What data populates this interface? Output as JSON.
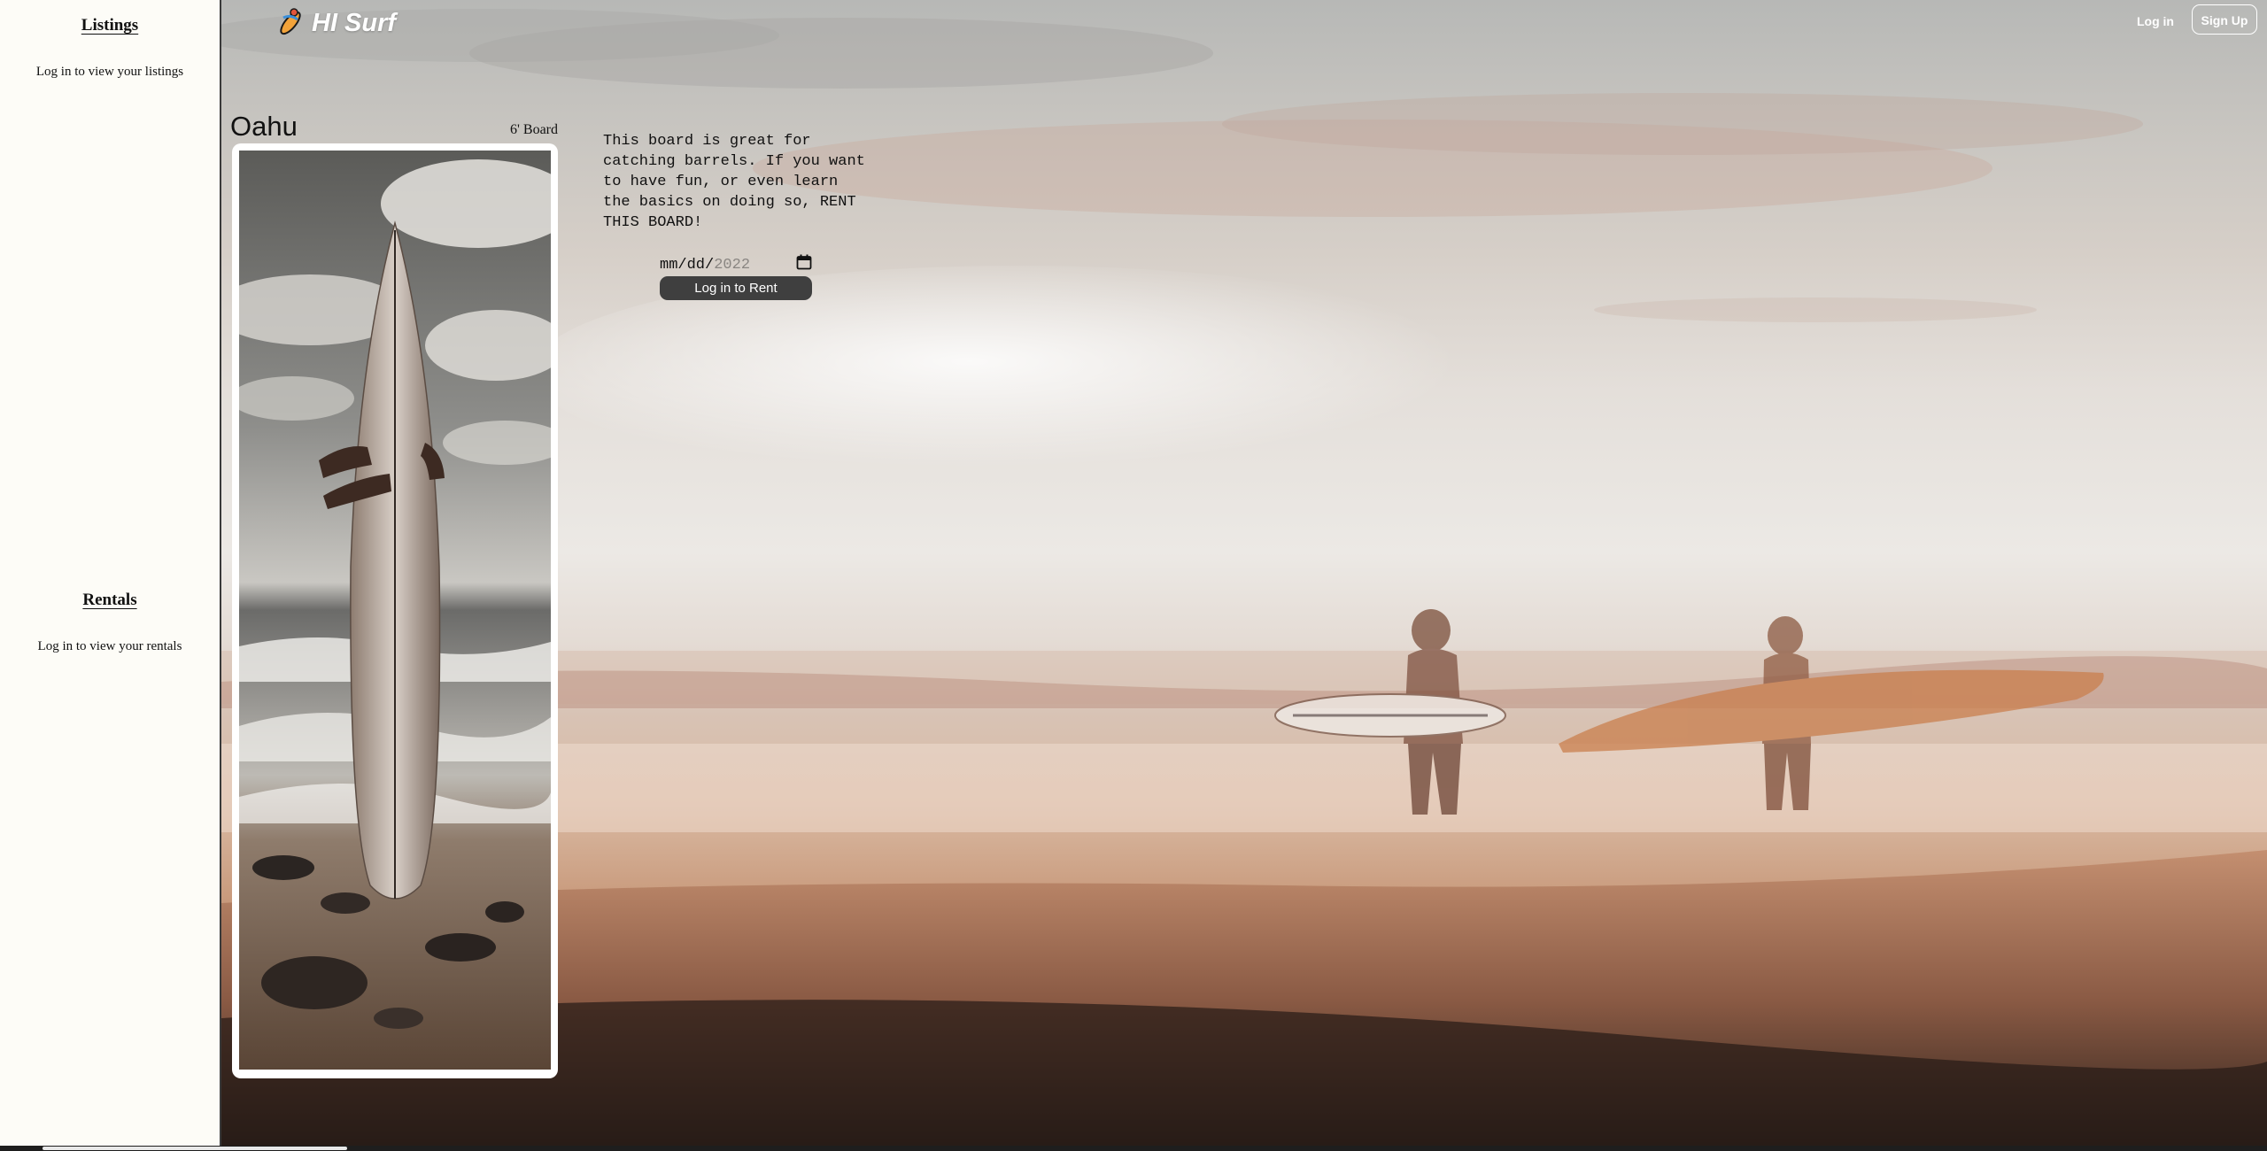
{
  "header": {
    "brand_title": "HI Surf",
    "logo_icon": "surfer-logo-icon",
    "login_label": "Log in",
    "signup_label": "Sign Up"
  },
  "sidebar": {
    "listings_heading": "Listings",
    "listings_text": "Log in to view your listings",
    "rentals_heading": "Rentals",
    "rentals_text": "Log in to view your rentals"
  },
  "listing": {
    "location": "Oahu",
    "board_size": "6' Board",
    "description": "This board is great for catching barrels. If you want to have fun, or even learn the basics on doing so, RENT THIS BOARD!",
    "date_placeholder": "mm/dd/",
    "date_year": "2022",
    "rent_button_label": "Log in to Rent"
  },
  "colors": {
    "sidebar_bg": "#fdfcf7",
    "button_bg": "#3f3f3f",
    "text": "#111111"
  }
}
